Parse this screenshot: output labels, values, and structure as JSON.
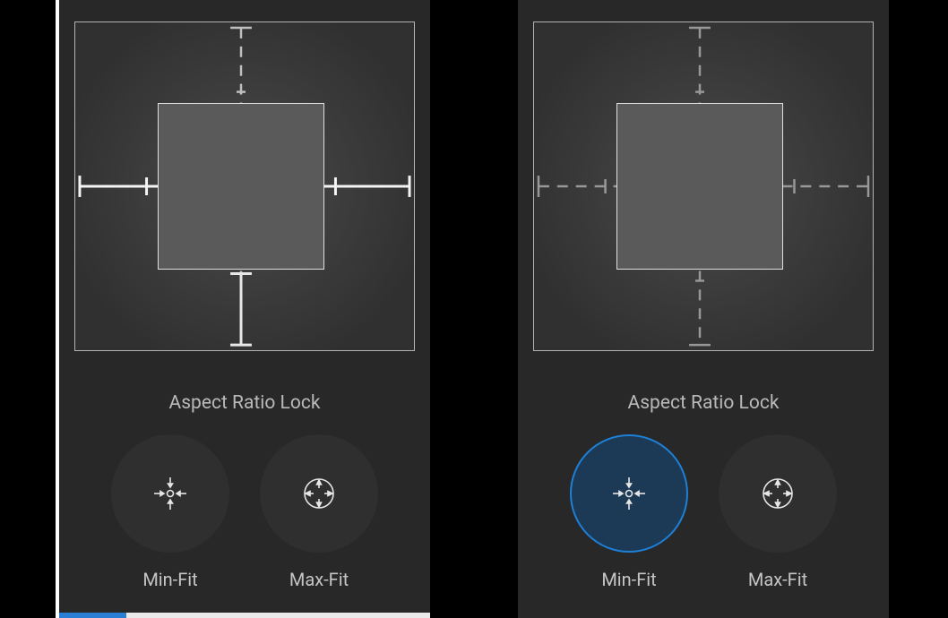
{
  "left_panel": {
    "section_label": "Aspect Ratio Lock",
    "min_fit": {
      "label": "Min-Fit",
      "selected": false
    },
    "max_fit": {
      "label": "Max-Fit",
      "selected": false
    }
  },
  "right_panel": {
    "section_label": "Aspect Ratio Lock",
    "min_fit": {
      "label": "Min-Fit",
      "selected": true
    },
    "max_fit": {
      "label": "Max-Fit",
      "selected": false
    }
  }
}
